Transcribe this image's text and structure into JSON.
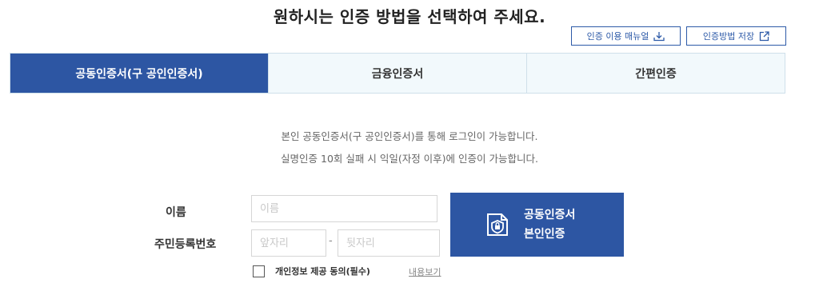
{
  "page_title": "원하시는 인증 방법을 선택하여 주세요.",
  "top_buttons": {
    "manual_label": "인증 이용 매뉴얼",
    "save_label": "인증방법 저장"
  },
  "tabs": [
    {
      "label": "공동인증서(구 공인인증서)",
      "active": true
    },
    {
      "label": "금융인증서",
      "active": false
    },
    {
      "label": "간편인증",
      "active": false
    }
  ],
  "description": {
    "line1": "본인 공동인증서(구 공인인증서)를 통해 로그인이 가능합니다.",
    "line2": "실명인증 10회 실패 시 익일(자정 이후)에 인증이 가능합니다."
  },
  "form": {
    "name_label": "이름",
    "name_placeholder": "이름",
    "rrn_label": "주민등록번호",
    "rrn_front_placeholder": "앞자리",
    "rrn_separator": "-",
    "rrn_back_placeholder": "뒷자리"
  },
  "cert_button": {
    "line1": "공동인증서",
    "line2": "본인인증",
    "icon": "certificate-lock-icon"
  },
  "agreement": {
    "label": "개인정보 제공 동의(필수)",
    "view_link": "내용보기",
    "checked": false
  },
  "colors": {
    "primary": "#2d56a3",
    "tab_bg": "#f2f9fc",
    "tab_border": "#cfe0ea"
  }
}
